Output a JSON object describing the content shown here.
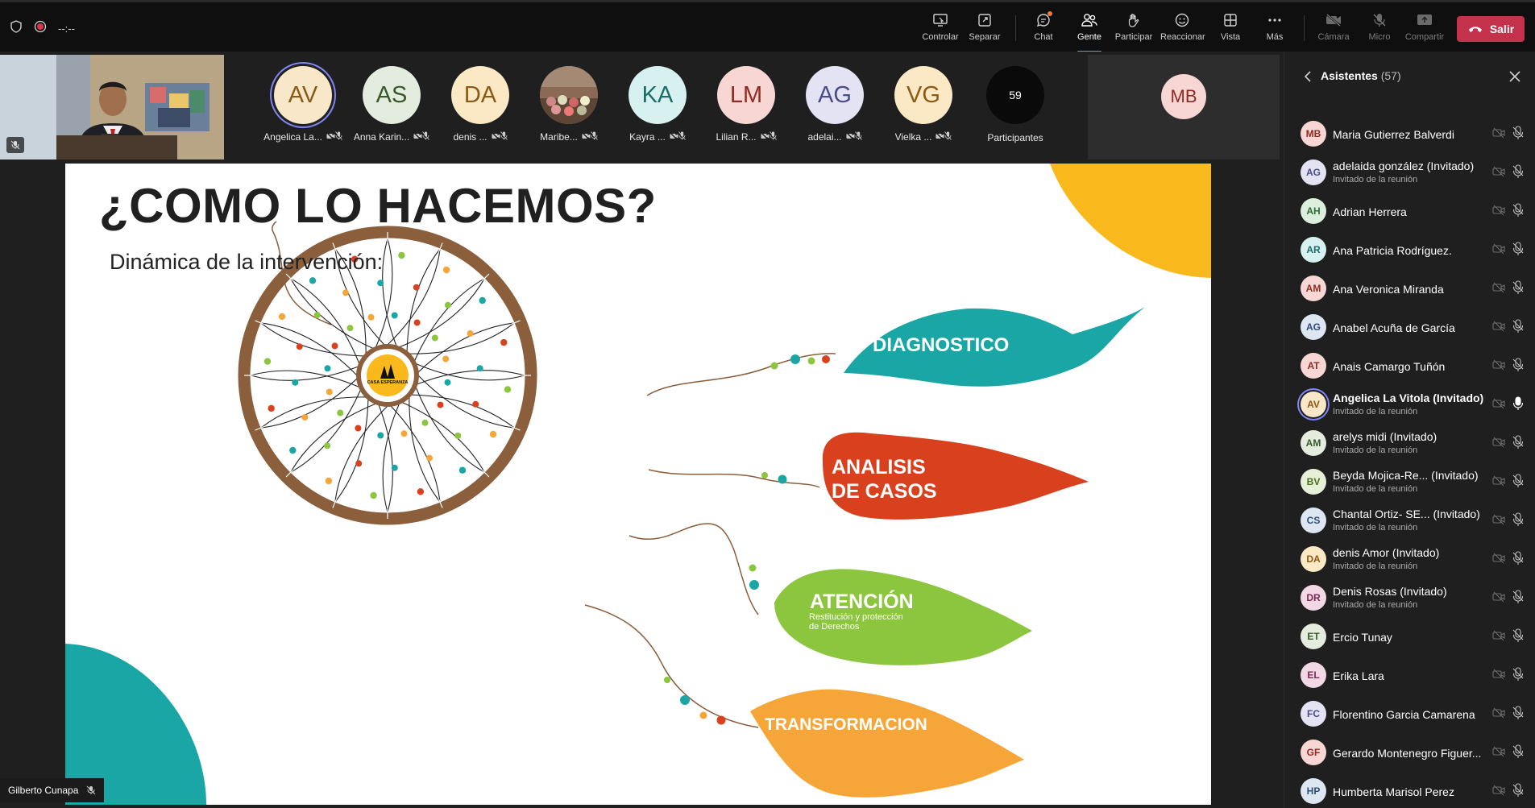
{
  "topbar": {
    "timer": "--:--",
    "buttons": {
      "control": "Controlar",
      "detach": "Separar",
      "chat": "Chat",
      "people": "Gente",
      "raise": "Participar",
      "react": "Reaccionar",
      "view": "Vista",
      "more": "Más",
      "camera": "Cámara",
      "mic": "Micro",
      "share": "Compartir",
      "leave": "Salir"
    }
  },
  "strip": {
    "participants": [
      {
        "initials": "AV",
        "name": "Angelica La...",
        "bg": "#f8e7c9",
        "fg": "#8a5a14",
        "ring": true
      },
      {
        "initials": "AS",
        "name": "Anna Karin...",
        "bg": "#e3ecde",
        "fg": "#37592a"
      },
      {
        "initials": "DA",
        "name": "denis ...",
        "bg": "#fbe8c5",
        "fg": "#8a5a14"
      },
      {
        "initials": "",
        "name": "Maribe...",
        "bg": "#8a6a55",
        "fg": "#fff",
        "photo": true
      },
      {
        "initials": "KA",
        "name": "Kayra ...",
        "bg": "#d6f1f0",
        "fg": "#1b6c6a"
      },
      {
        "initials": "LM",
        "name": "Lilian R...",
        "bg": "#f7d6d3",
        "fg": "#8e2b22"
      },
      {
        "initials": "AG",
        "name": "adelai...",
        "bg": "#e3e3f3",
        "fg": "#4b4b85"
      },
      {
        "initials": "VG",
        "name": "Vielka ...",
        "bg": "#fbe8c5",
        "fg": "#8a5a14"
      }
    ],
    "overflow": {
      "count": "59",
      "label": "Participantes"
    },
    "highlight_initials": "MB"
  },
  "slide": {
    "title": "¿COMO LO HACEMOS?",
    "subtitle": "Dinámica de la intervención:",
    "logo_text": "CASA ESPERANZA",
    "leaves": {
      "diagnostico": "DIAGNOSTICO",
      "analisis_1": "ANALISIS",
      "analisis_2": "DE CASOS",
      "atencion": "ATENCIÓN",
      "atencion_sub_1": "Restitución y protección",
      "atencion_sub_2": "de Derechos",
      "transformacion": "TRANSFORMACION"
    },
    "colors": {
      "teal": "#1ba6a6",
      "red": "#d9411e",
      "green": "#8cc63f",
      "orange": "#f6a639",
      "yellow": "#f9b91c",
      "brown": "#8b5e3c"
    }
  },
  "presenter": {
    "name": "Gilberto Cunapa"
  },
  "sidebar": {
    "title": "Asistentes",
    "count": "(57)",
    "subtitle_guest": "Invitado de la reunión",
    "attendees": [
      {
        "initials": "MB",
        "name": "Maria Gutierrez Balverdi",
        "bg": "#f7d6d3",
        "fg": "#8e2b22"
      },
      {
        "initials": "AG",
        "name": "adelaida gonzález (Invitado)",
        "bg": "#e3e3f3",
        "fg": "#4b4b85",
        "guest": true
      },
      {
        "initials": "AH",
        "name": "Adrian Herrera",
        "bg": "#dceedd",
        "fg": "#2f6b33"
      },
      {
        "initials": "AR",
        "name": "Ana Patricia Rodríguez.",
        "bg": "#d6f1f0",
        "fg": "#1b6c6a"
      },
      {
        "initials": "AM",
        "name": "Ana Veronica Miranda",
        "bg": "#f7d6d3",
        "fg": "#8e2b22"
      },
      {
        "initials": "AG",
        "name": "Anabel Acuña de García",
        "bg": "#dde6f1",
        "fg": "#2d4d78"
      },
      {
        "initials": "AT",
        "name": "Anais Camargo Tuñón",
        "bg": "#f7d6d3",
        "fg": "#8e2b22"
      },
      {
        "initials": "AV",
        "name": "Angelica La Vitola (Invitado)",
        "bg": "#f8e7c9",
        "fg": "#8a5a14",
        "guest": true,
        "speaking": true
      },
      {
        "initials": "AM",
        "name": "arelys midi (Invitado)",
        "bg": "#e3ecde",
        "fg": "#37592a",
        "guest": true
      },
      {
        "initials": "BV",
        "name": "Beyda Mojica-Re... (Invitado)",
        "bg": "#e6f0d6",
        "fg": "#4f6b1e",
        "guest": true
      },
      {
        "initials": "CS",
        "name": "Chantal Ortiz- SE... (Invitado)",
        "bg": "#dde6f1",
        "fg": "#2d4d78",
        "guest": true
      },
      {
        "initials": "DA",
        "name": "denis Amor (Invitado)",
        "bg": "#fbe8c5",
        "fg": "#8a5a14",
        "guest": true
      },
      {
        "initials": "DR",
        "name": "Denis Rosas (Invitado)",
        "bg": "#f2d8e5",
        "fg": "#7c2a55",
        "guest": true
      },
      {
        "initials": "ET",
        "name": "Ercio Tunay",
        "bg": "#e3ecde",
        "fg": "#37592a"
      },
      {
        "initials": "EL",
        "name": "Erika Lara",
        "bg": "#f2d8e5",
        "fg": "#7c2a55"
      },
      {
        "initials": "FC",
        "name": "Florentino Garcia Camarena",
        "bg": "#e3e3f3",
        "fg": "#4b4b85"
      },
      {
        "initials": "GF",
        "name": "Gerardo Montenegro Figuer...",
        "bg": "#f7d6d3",
        "fg": "#8e2b22"
      },
      {
        "initials": "HP",
        "name": "Humberta Marisol Perez",
        "bg": "#dde6f1",
        "fg": "#2d4d78"
      }
    ]
  }
}
